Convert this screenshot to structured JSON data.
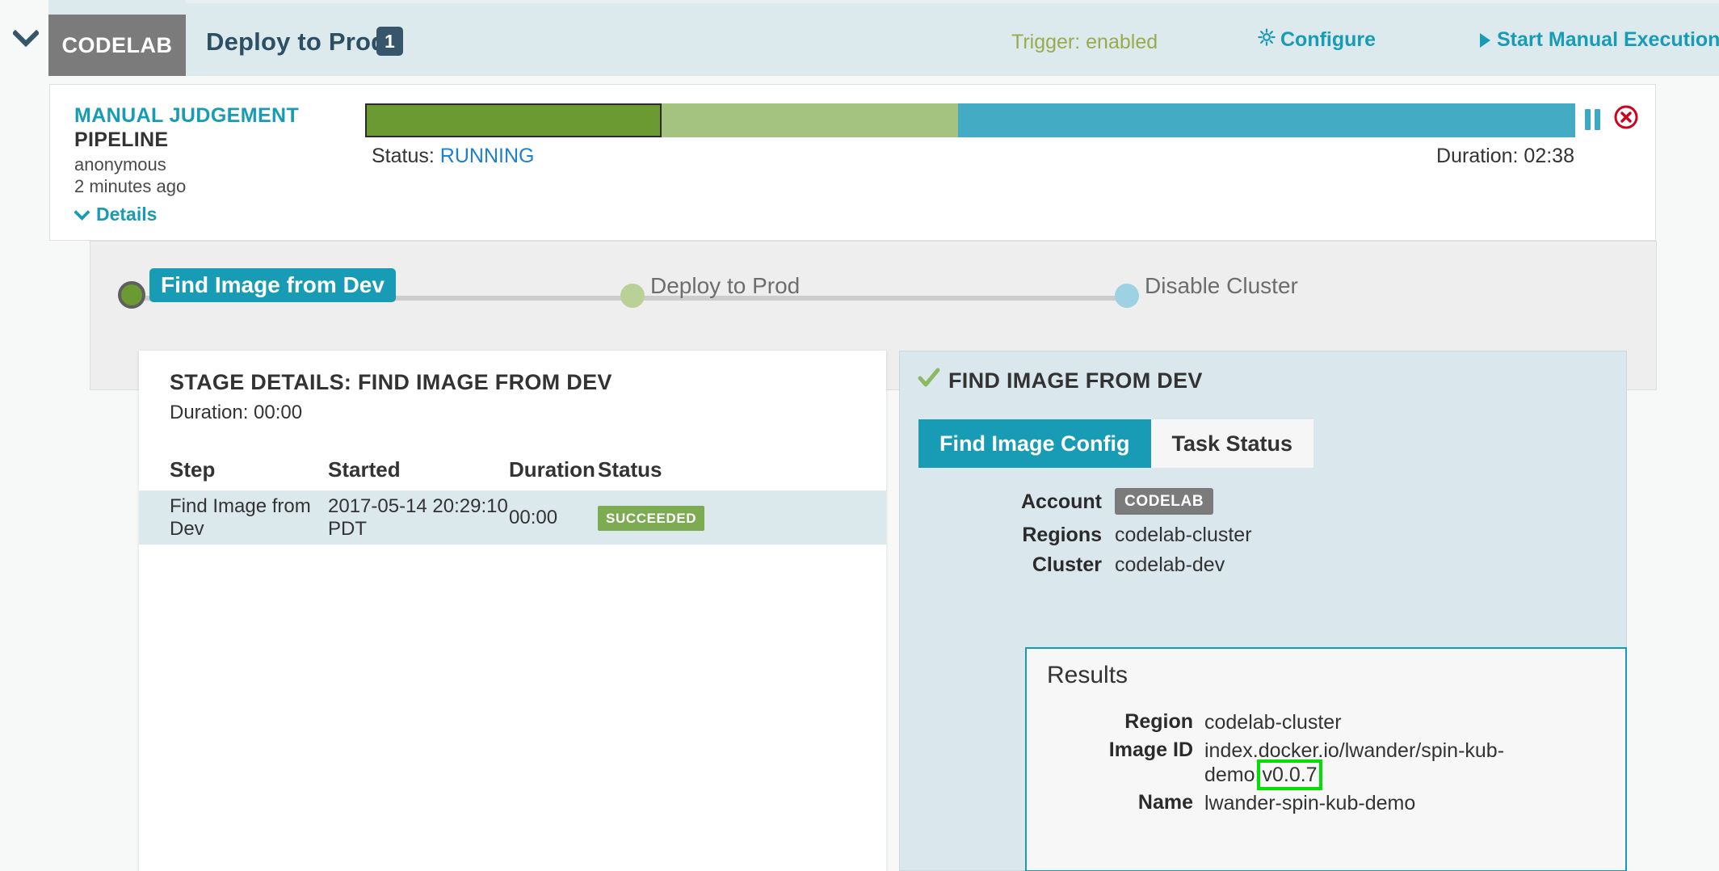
{
  "header": {
    "toggle_icon": "chevron-down-icon",
    "account": "CODELAB",
    "pipeline_name": "Deploy to Prod",
    "execution_count": "1",
    "trigger_status": "Trigger: enabled",
    "configure_label": "Configure",
    "configure_icon": "gear-icon",
    "start_execution_label": "Start Manual Execution",
    "start_execution_icon": "play-icon",
    "colors": {
      "strip_bg": "#dce9ed",
      "account_bg": "#7b7b7b",
      "link": "#189cb5",
      "trigger": "#9aab4e",
      "title": "#2d4f63"
    }
  },
  "execution": {
    "type": "MANUAL JUDGEMENT",
    "kind": "PIPELINE",
    "user": "anonymous",
    "age": "2 minutes ago",
    "details_label": "Details",
    "details_icon": "chevron-down-icon",
    "status_label": "Status:",
    "status_value": "RUNNING",
    "duration_label": "Duration: 02:38",
    "pause_icon": "pause-icon",
    "stop_icon": "stop-circle-icon",
    "progress": {
      "segments": [
        {
          "name": "Find Image from Dev",
          "width_pct": 24.5,
          "state": "active",
          "color": "#6b9a32"
        },
        {
          "name": "Deploy to Prod",
          "width_pct": 24.5,
          "state": "pending",
          "color": "#a4c380"
        },
        {
          "name": "Disable Cluster",
          "width_pct": 51.0,
          "state": "pending",
          "color": "#43acc4"
        }
      ]
    }
  },
  "graph": {
    "stages": [
      {
        "label": "Find Image from Dev",
        "state": "running",
        "selected": true,
        "color": "#6b9a32"
      },
      {
        "label": "Deploy to Prod",
        "state": "not-started",
        "selected": false,
        "color": "#b9d097"
      },
      {
        "label": "Disable Cluster",
        "state": "not-started",
        "selected": false,
        "color": "#9ed2e2"
      }
    ]
  },
  "stage_details": {
    "title": "STAGE DETAILS: FIND IMAGE FROM DEV",
    "duration": "Duration: 00:00",
    "columns": [
      "Step",
      "Started",
      "Duration",
      "Status"
    ],
    "rows": [
      {
        "step": "Find Image from Dev",
        "started": "2017-05-14 20:29:10 PDT",
        "duration": "00:00",
        "status": "SUCCEEDED"
      }
    ],
    "status_color": "#7cab51"
  },
  "config_panel": {
    "title": "FIND IMAGE FROM DEV",
    "title_icon": "check-icon",
    "tabs": [
      {
        "label": "Find Image Config",
        "active": true
      },
      {
        "label": "Task Status",
        "active": false
      }
    ],
    "fields": [
      {
        "key": "Account",
        "value": "CODELAB",
        "type": "chip"
      },
      {
        "key": "Regions",
        "value": "codelab-cluster",
        "type": "text"
      },
      {
        "key": "Cluster",
        "value": "codelab-dev",
        "type": "text"
      }
    ],
    "results": {
      "title": "Results",
      "fields": [
        {
          "key": "Region",
          "value": "codelab-cluster"
        },
        {
          "key": "Image ID",
          "value_prefix": "index.docker.io/lwander/spin-kub-demo:",
          "value_highlight": "v0.0.7"
        },
        {
          "key": "Name",
          "value": "lwander-spin-kub-demo"
        }
      ],
      "highlight_color": "#00e000",
      "border_color": "#189cb5"
    }
  }
}
